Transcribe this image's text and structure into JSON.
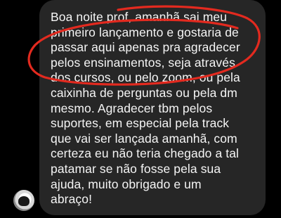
{
  "message": {
    "lines": [
      "Boa noite prof, amanhã sai meu",
      "primeiro lançamento e gostaria de",
      "passar aqui apenas pra agradecer",
      "pelos ensinamentos, seja através",
      "dos cursos, ou pelo zoom, ou pela",
      "caixinha de perguntas ou pela dm",
      "mesmo. Agradecer tbm pelos",
      "suportes, em especial pela track",
      "que vai ser lançada amanhã, com",
      "certeza eu não teria chegado a tal",
      "patamar se não fosse pela sua",
      "ajuda, muito obrigado e um",
      "abraço!"
    ]
  },
  "colors": {
    "background": "#000000",
    "bubble": "#262626",
    "text": "#f5f5f5",
    "annotation": "#e32a1f"
  },
  "annotation": {
    "shape": "hand-drawn-ellipse"
  }
}
